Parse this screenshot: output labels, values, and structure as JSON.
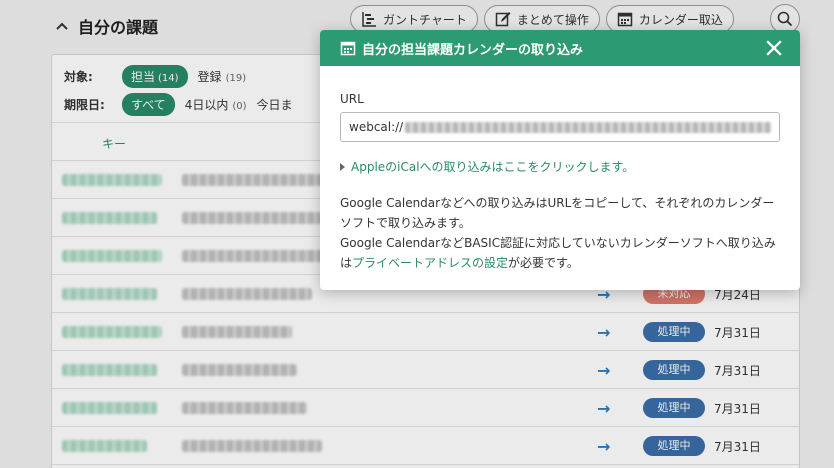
{
  "header": {
    "title": "自分の課題",
    "toolbar": {
      "gantt_label": "ガントチャート",
      "bulk_label": "まとめて操作",
      "calendar_label": "カレンダー取込"
    }
  },
  "filters": {
    "target_label": "対象:",
    "target_options": [
      {
        "label": "担当",
        "count": "(14)",
        "selected": true
      },
      {
        "label": "登録",
        "count": "(19)",
        "selected": false
      }
    ],
    "due_label": "期限日:",
    "due_options": [
      {
        "label": "すべて",
        "count": "",
        "selected": true
      },
      {
        "label": "4日以内",
        "count": "(0)",
        "selected": false
      },
      {
        "label": "今日ま",
        "count": "",
        "selected": false
      }
    ]
  },
  "table": {
    "key_header": "キー",
    "rows": [
      {
        "status": "",
        "date": ""
      },
      {
        "status": "",
        "date": ""
      },
      {
        "status": "",
        "date": ""
      },
      {
        "status": "未対応",
        "date": "7月24日"
      },
      {
        "status": "処理中",
        "date": "7月31日"
      },
      {
        "status": "処理中",
        "date": "7月31日"
      },
      {
        "status": "処理中",
        "date": "7月31日"
      },
      {
        "status": "処理中",
        "date": "7月31日"
      }
    ]
  },
  "modal": {
    "title": "自分の担当課題カレンダーの取り込み",
    "url_label": "URL",
    "url_prefix": "webcal://",
    "apple_link": "AppleのiCalへの取り込みはここをクリックします。",
    "desc_line1": "Google Calendarなどへの取り込みはURLをコピーして、それぞれのカレンダーソフトで取り込みます。",
    "desc_line2_a": "Google CalendarなどBASIC認証に対応していないカレンダーソフトへ取り込みは",
    "desc_line2_link": "プライベートアドレスの設定",
    "desc_line2_b": "が必要です。"
  },
  "colors": {
    "accent": "#2c9a72",
    "status_unhandled": "#e07c6e",
    "status_working": "#3a6ea8",
    "arrow": "#2e7bbf"
  }
}
